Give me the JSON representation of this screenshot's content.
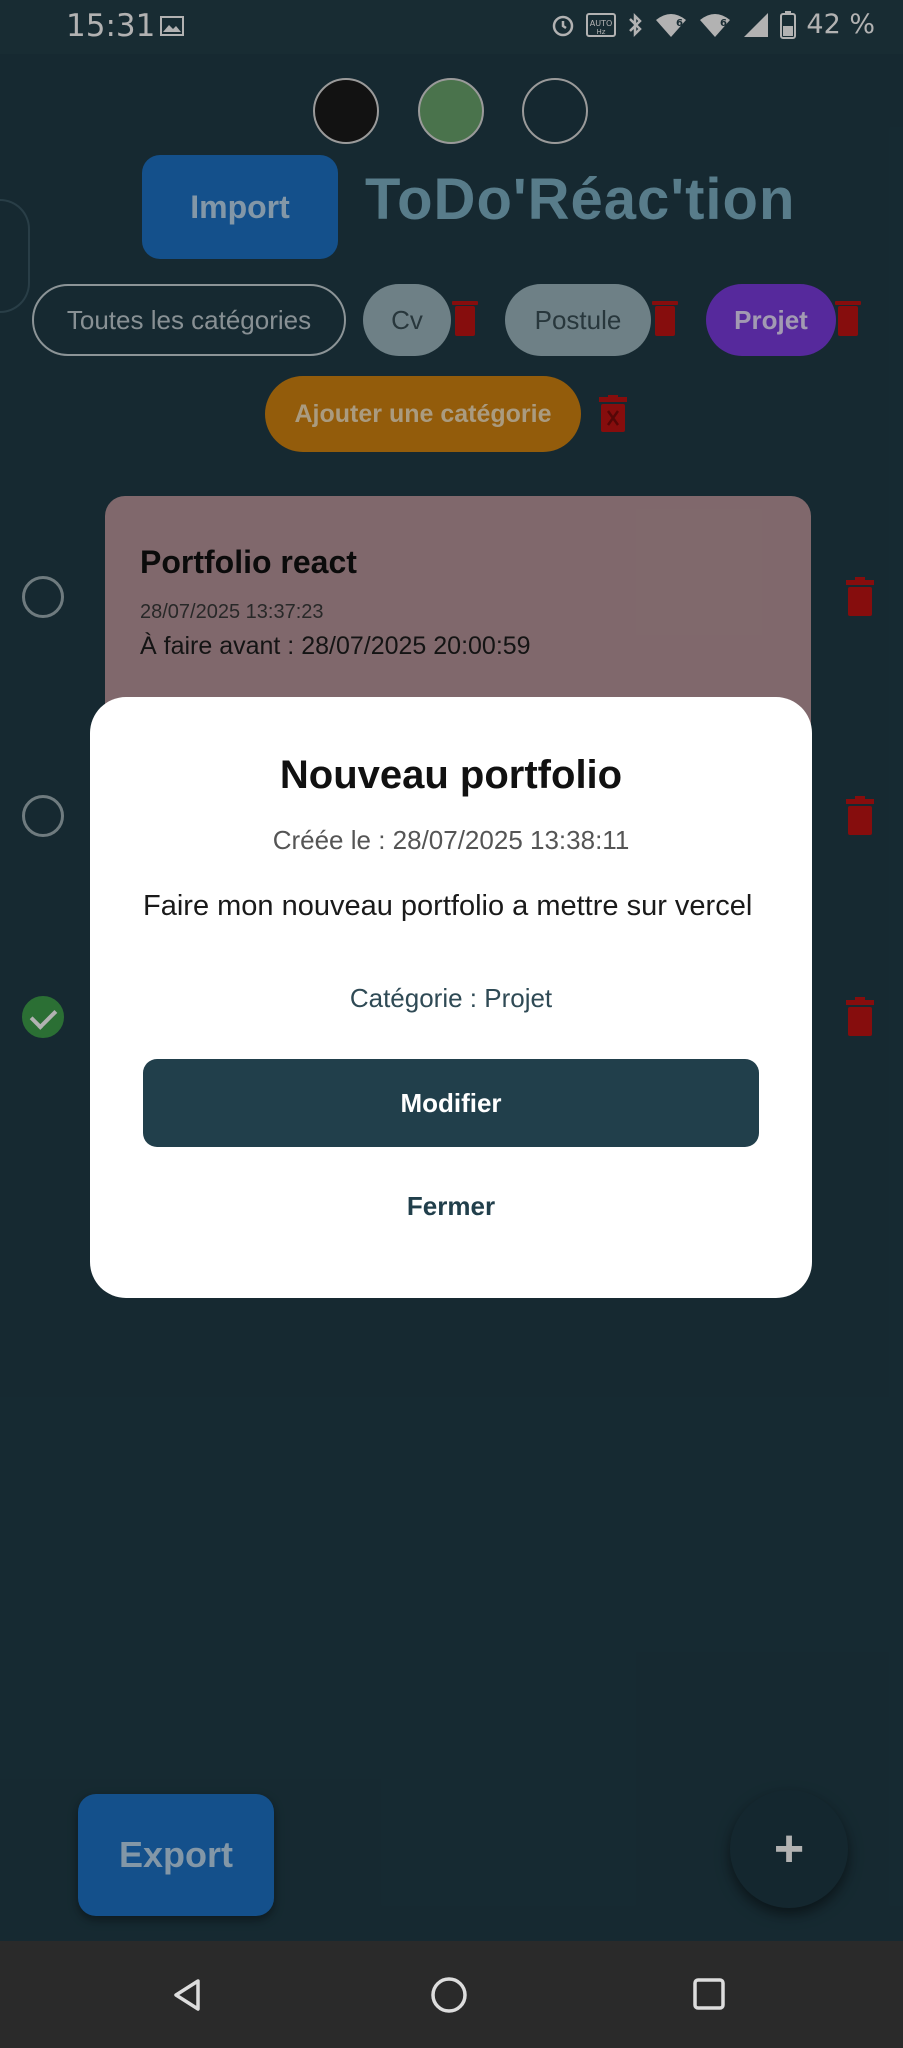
{
  "status_bar": {
    "time": "15:31",
    "battery": "42 %",
    "icons": [
      "image-icon",
      "alarm-icon",
      "auto-hz-icon",
      "bluetooth-icon",
      "wifi6-icon",
      "wifi6-icon",
      "signal-icon",
      "battery-icon"
    ]
  },
  "app": {
    "title": "ToDo'Réac'tion",
    "import_label": "Import",
    "export_label": "Export",
    "fab_label": "+",
    "theme_dots": [
      {
        "name": "theme-dark",
        "color": "#1b1b1b"
      },
      {
        "name": "theme-green",
        "color": "#6aa56d"
      },
      {
        "name": "theme-teal",
        "color": "#1f3a45"
      }
    ],
    "categories": [
      {
        "label": "Toutes les catégories"
      },
      {
        "label": "Cv"
      },
      {
        "label": "Postule"
      },
      {
        "label": "Projet"
      }
    ],
    "add_category_label": "Ajouter une catégorie"
  },
  "tasks": [
    {
      "title": "Portfolio react",
      "created": "28/07/2025 13:37:23",
      "due": "À faire avant : 28/07/2025 20:00:59",
      "done": false
    },
    {
      "done": false
    },
    {
      "done": true
    }
  ],
  "modal": {
    "title": "Nouveau portfolio",
    "created": "Créée le : 28/07/2025 13:38:11",
    "description": "Faire mon nouveau portfolio a mettre sur vercel",
    "category": "Catégorie : Projet",
    "modify_label": "Modifier",
    "close_label": "Fermer"
  },
  "colors": {
    "background": "#203c47",
    "accent_blue": "#1e73c8",
    "accent_orange": "#d38410",
    "accent_purple": "#7c3be0",
    "trash_red": "#c01313",
    "done_green": "#3e9f4b"
  }
}
